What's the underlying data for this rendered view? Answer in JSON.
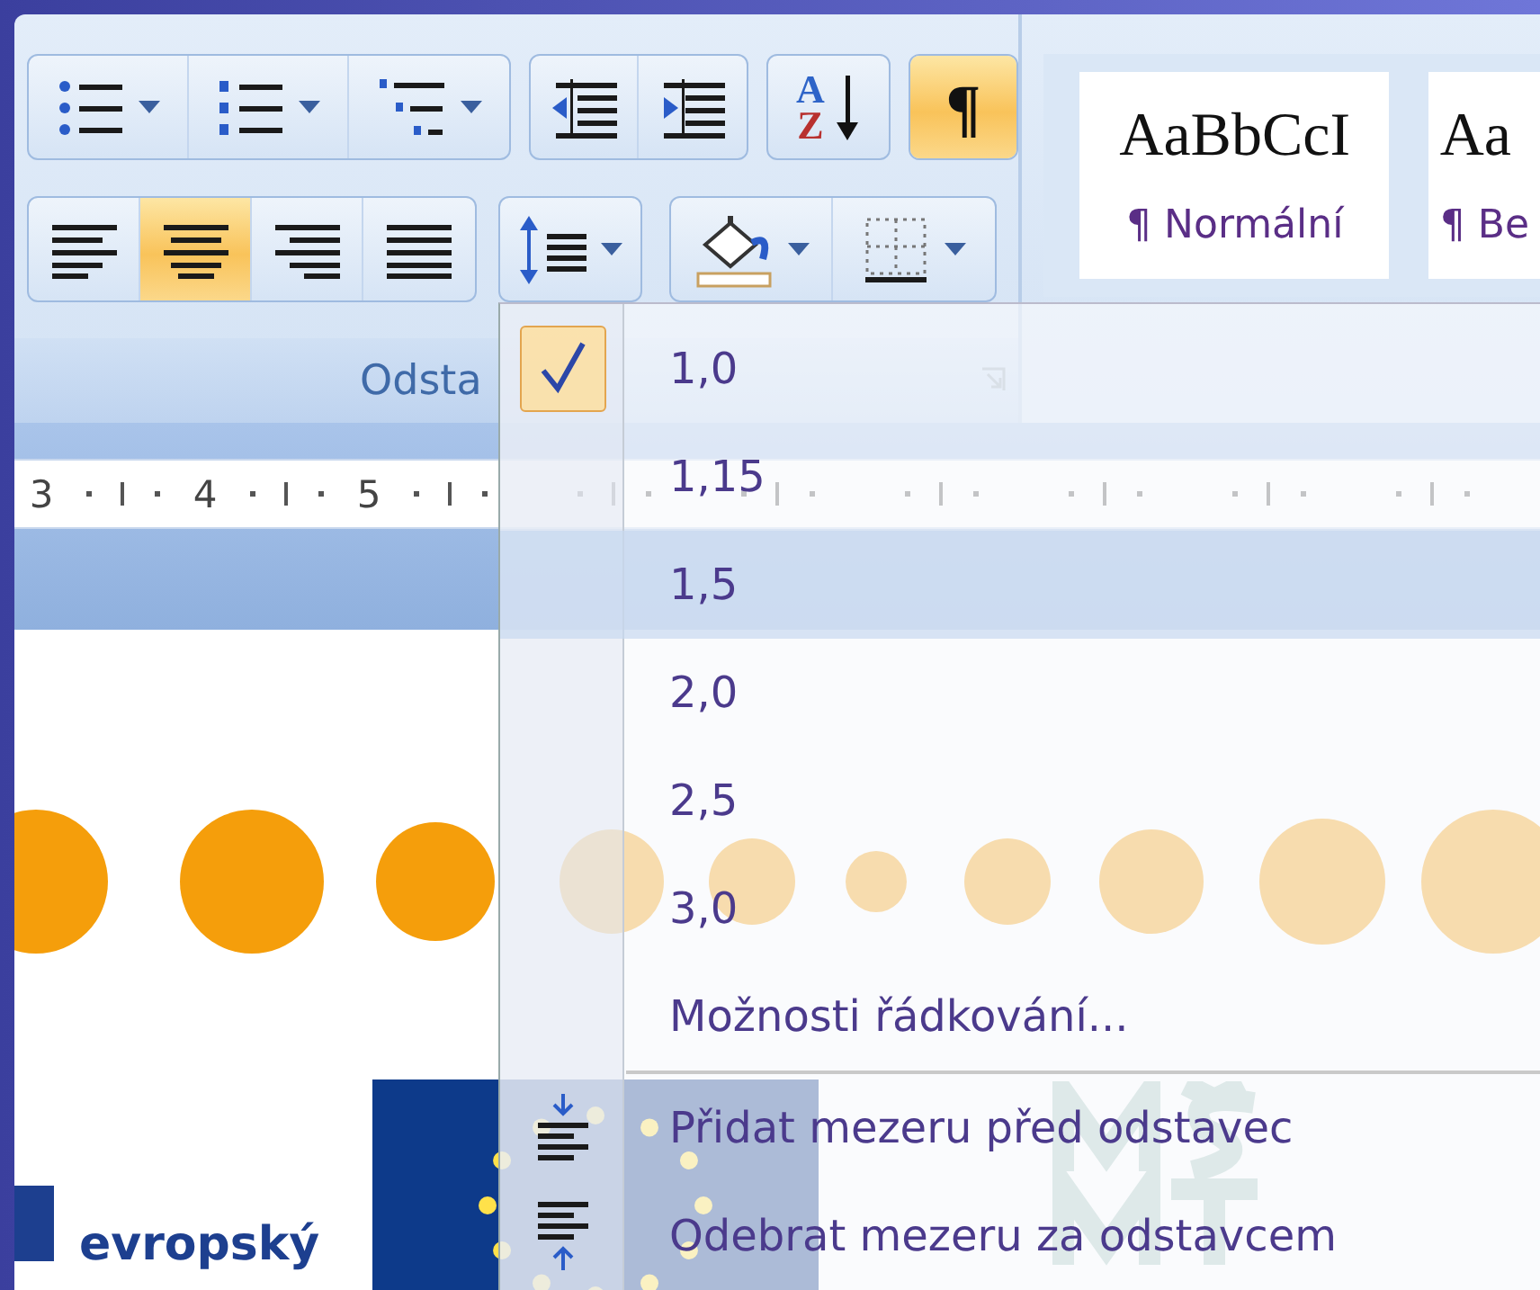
{
  "ribbon": {
    "paragraph_group": {
      "label": "Odsta",
      "rows": [
        [
          [
            {
              "kind": "bullets",
              "selected": false
            },
            {
              "kind": "numbering",
              "selected": false
            },
            {
              "kind": "multilevel",
              "selected": false
            }
          ],
          [
            {
              "kind": "decrease-indent",
              "selected": false
            },
            {
              "kind": "increase-indent",
              "selected": false
            }
          ],
          [
            {
              "kind": "sort",
              "selected": false,
              "glyphs": [
                "A",
                "Z"
              ]
            }
          ],
          [
            {
              "kind": "pilcrow",
              "selected": true,
              "glyph": "¶"
            }
          ]
        ],
        [
          [
            {
              "kind": "align-left",
              "selected": false
            },
            {
              "kind": "align-center",
              "selected": true
            },
            {
              "kind": "align-right",
              "selected": false
            },
            {
              "kind": "justify",
              "selected": false
            }
          ],
          [
            {
              "kind": "line-spacing",
              "selected": false
            }
          ],
          [
            {
              "kind": "shading",
              "selected": false
            },
            {
              "kind": "borders",
              "selected": false
            }
          ]
        ]
      ]
    },
    "styles": [
      {
        "sample": "AaBbCcI",
        "name": "¶ Normální"
      },
      {
        "sample": "Aa",
        "name": "¶ Be"
      }
    ]
  },
  "ruler": {
    "numbers": [
      "3",
      "4",
      "5"
    ]
  },
  "document": {
    "logo_text": "evropský"
  },
  "spacing_menu": {
    "items": [
      {
        "kind": "value",
        "label": "1,0",
        "checked": true,
        "selected": false
      },
      {
        "kind": "value",
        "label": "1,15",
        "checked": false,
        "selected": false
      },
      {
        "kind": "value",
        "label": "1,5",
        "checked": false,
        "selected": true
      },
      {
        "kind": "value",
        "label": "2,0",
        "checked": false,
        "selected": false
      },
      {
        "kind": "value",
        "label": "2,5",
        "checked": false,
        "selected": false
      },
      {
        "kind": "value",
        "label": "3,0",
        "checked": false,
        "selected": false
      },
      {
        "kind": "options",
        "label": "Možnosti řádkování...",
        "checked": false,
        "selected": false
      },
      {
        "kind": "add-before",
        "label": "Přidat mezeru před odstavec",
        "checked": false,
        "selected": false
      },
      {
        "kind": "remove-after",
        "label": "Odebrat mezeru za odstavcem",
        "checked": false,
        "selected": false
      }
    ]
  }
}
